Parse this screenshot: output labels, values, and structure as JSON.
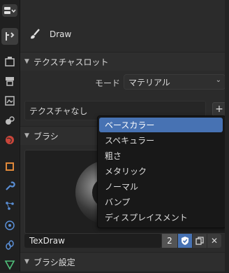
{
  "header": {
    "title": "Draw"
  },
  "sections": {
    "texture_slots": "テクスチャスロット",
    "brush": "ブラシ",
    "brush_settings": "ブラシ設定"
  },
  "mode": {
    "label": "モード",
    "value": "マテリアル"
  },
  "texture_list": {
    "empty_text": "テクスチャなし",
    "add_symbol": "+"
  },
  "dropdown_menu": {
    "items": [
      "ベースカラー",
      "スペキュラー",
      "粗さ",
      "メタリック",
      "ノーマル",
      "バンプ",
      "ディスプレイスメント"
    ],
    "selected_index": 0
  },
  "brush_selector": {
    "name": "TexDraw",
    "users": "2",
    "close_symbol": "✕"
  },
  "colors": {
    "accent": "#4772b3",
    "panel": "#2b2b2b",
    "menu_bg": "#181818"
  }
}
